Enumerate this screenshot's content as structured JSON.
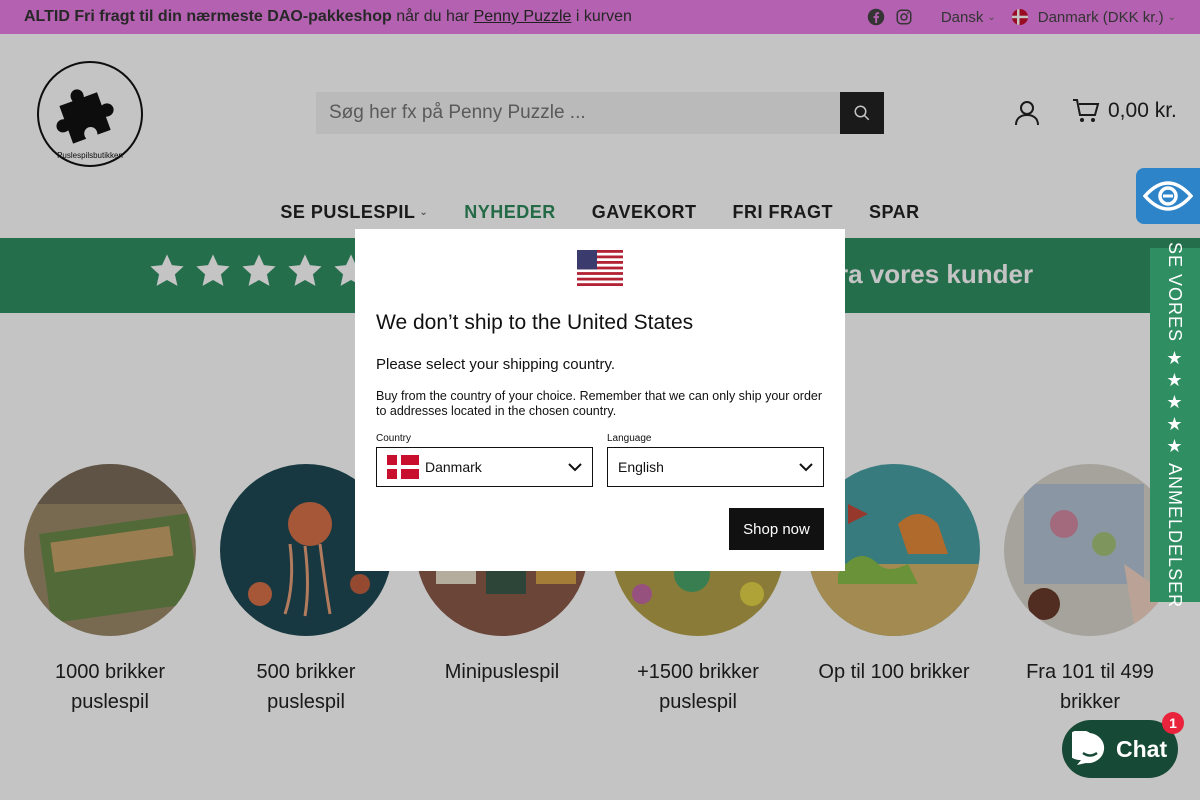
{
  "announcement": {
    "bold_text": "ALTID Fri fragt til din nærmeste DAO-pakkeshop",
    "mid_text": " når du har ",
    "link_text": "Penny Puzzle",
    "tail_text": " i kurven"
  },
  "topbar": {
    "language": "Dansk",
    "country": "Danmark (DKK kr.)",
    "social_icons": [
      "facebook-icon",
      "instagram-icon"
    ]
  },
  "header": {
    "search_placeholder": "Søg her fx på Penny Puzzle ...",
    "cart_total": "0,00 kr."
  },
  "nav": {
    "items": [
      {
        "label": "SE PUSLESPIL",
        "has_dropdown": true
      },
      {
        "label": "NYHEDER",
        "active": true
      },
      {
        "label": "GAVEKORT"
      },
      {
        "label": "FRI FRAGT"
      },
      {
        "label": "SPAR"
      }
    ]
  },
  "reviews_banner": {
    "star_count": 5,
    "text": "r fra vores kunder"
  },
  "categories": [
    {
      "label": "1000 brikker puslespil"
    },
    {
      "label": "500 brikker puslespil"
    },
    {
      "label": "Minipuslespil"
    },
    {
      "label": "+1500 brikker puslespil"
    },
    {
      "label": "Op til 100 brikker"
    },
    {
      "label": "Fra 101 til 499 brikker"
    }
  ],
  "reviews_tab": {
    "text": "SE VORES ★★★★★ ANMELDELSER"
  },
  "chat": {
    "label": "Chat",
    "badge": "1"
  },
  "modal": {
    "title": "We don’t ship to the United States",
    "subtitle": "Please select your shipping country.",
    "body": "Buy from the country of your choice. Remember that we can only ship your order to addresses located in the chosen country.",
    "country_label": "Country",
    "country_value": "Danmark",
    "language_label": "Language",
    "language_value": "English",
    "shop_button": "Shop now"
  },
  "colors": {
    "announcement_bg": "#e97fe6",
    "brand_green": "#2f8f63",
    "accessibility_blue": "#2d84c8",
    "chat_bg": "#174a36"
  }
}
